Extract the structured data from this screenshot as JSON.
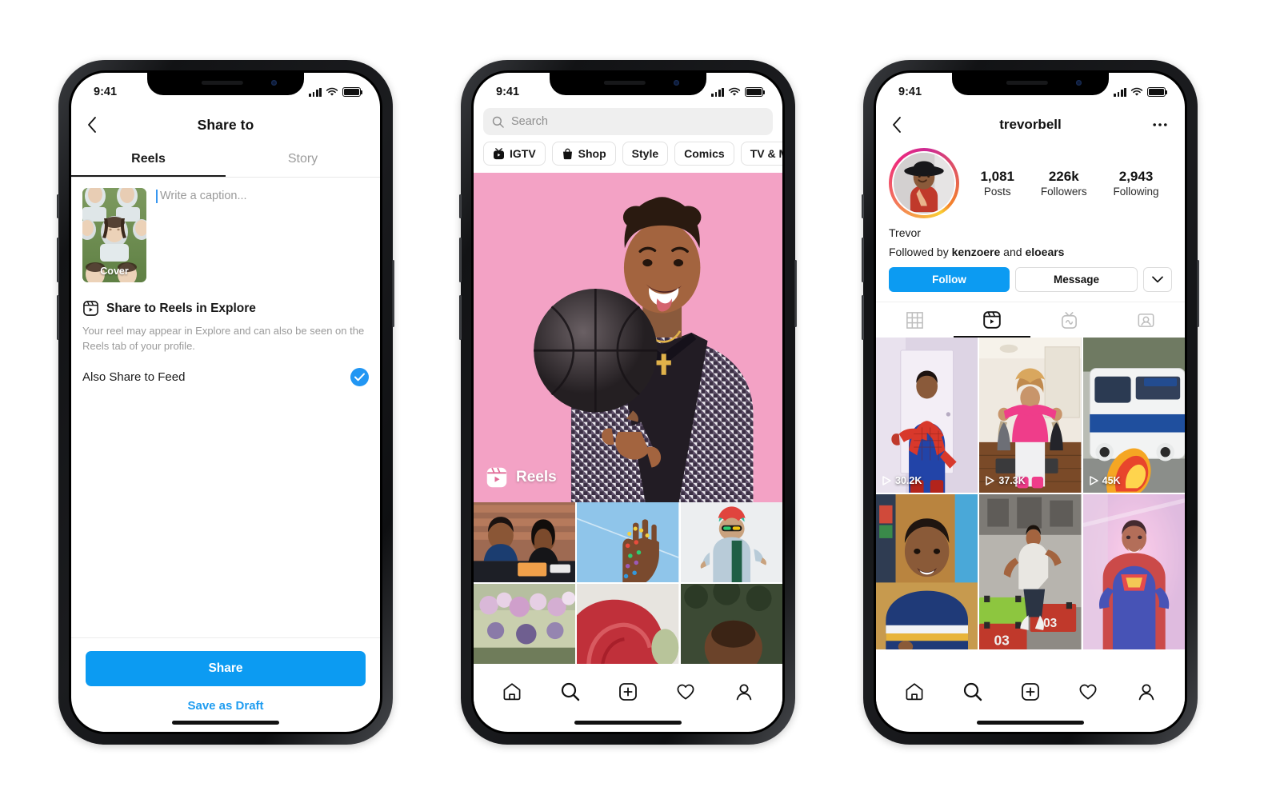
{
  "colors": {
    "accent_blue": "#0c9bf2",
    "link_blue": "#1e9cf0",
    "check_blue": "#2196f3",
    "text_dark": "#111111",
    "text_muted": "#9a9a9a",
    "hero_pink": "#f3a2c5"
  },
  "phone1": {
    "status": {
      "time": "9:41"
    },
    "nav": {
      "title": "Share to",
      "back_icon": "chevron-left-icon"
    },
    "tabs": [
      {
        "label": "Reels",
        "active": true
      },
      {
        "label": "Story",
        "active": false
      }
    ],
    "cover": {
      "label": "Cover"
    },
    "caption": {
      "placeholder": "Write a caption...",
      "value": ""
    },
    "explore": {
      "icon": "reels-icon",
      "heading": "Share to Reels in Explore",
      "description": "Your reel may appear in Explore and can also be seen on the Reels tab of your profile."
    },
    "also_share": {
      "label": "Also Share to Feed",
      "checked": true,
      "check_icon": "check-icon"
    },
    "footer": {
      "share_label": "Share",
      "draft_label": "Save as Draft"
    }
  },
  "phone2": {
    "status": {
      "time": "9:41"
    },
    "search": {
      "placeholder": "Search",
      "value": "",
      "icon": "search-icon"
    },
    "chips": [
      {
        "label": "IGTV",
        "icon": "igtv-icon"
      },
      {
        "label": "Shop",
        "icon": "shop-bag-icon"
      },
      {
        "label": "Style",
        "icon": null
      },
      {
        "label": "Comics",
        "icon": null
      },
      {
        "label": "TV & Movies",
        "icon": null
      }
    ],
    "hero": {
      "badge_label": "Reels",
      "badge_icon": "reels-icon"
    },
    "tabbar": [
      {
        "name": "home",
        "icon": "home-icon"
      },
      {
        "name": "search",
        "icon": "search-icon"
      },
      {
        "name": "create",
        "icon": "plus-square-icon"
      },
      {
        "name": "activity",
        "icon": "heart-icon"
      },
      {
        "name": "profile",
        "icon": "person-icon"
      }
    ]
  },
  "phone3": {
    "status": {
      "time": "9:41"
    },
    "nav": {
      "title": "trevorbell",
      "back_icon": "chevron-left-icon",
      "more_icon": "more-dots-icon"
    },
    "stats": [
      {
        "number": "1,081",
        "label": "Posts"
      },
      {
        "number": "226k",
        "label": "Followers"
      },
      {
        "number": "2,943",
        "label": "Following"
      }
    ],
    "bio": {
      "display_name": "Trevor",
      "followed_by_prefix": "Followed by ",
      "followed_by_1": "kenzoere",
      "followed_by_join": " and ",
      "followed_by_2": "eloears"
    },
    "actions": {
      "follow_label": "Follow",
      "message_label": "Message",
      "chevron_icon": "chevron-down-icon"
    },
    "tabs": [
      {
        "name": "grid",
        "icon": "grid-icon",
        "active": false
      },
      {
        "name": "reels",
        "icon": "reels-icon",
        "active": true
      },
      {
        "name": "igtv",
        "icon": "igtv-icon",
        "active": false
      },
      {
        "name": "tagged",
        "icon": "tagged-icon",
        "active": false
      }
    ],
    "grid": [
      {
        "views": "30.2K",
        "play_icon": "play-icon"
      },
      {
        "views": "37.3K",
        "play_icon": "play-icon"
      },
      {
        "views": "45K",
        "play_icon": "play-icon"
      },
      {
        "views": "",
        "play_icon": null
      },
      {
        "views": "",
        "play_icon": null
      },
      {
        "views": "",
        "play_icon": null
      }
    ],
    "tabbar": [
      {
        "name": "home",
        "icon": "home-icon"
      },
      {
        "name": "search",
        "icon": "search-icon"
      },
      {
        "name": "create",
        "icon": "plus-square-icon"
      },
      {
        "name": "activity",
        "icon": "heart-icon"
      },
      {
        "name": "profile",
        "icon": "person-icon"
      }
    ]
  }
}
